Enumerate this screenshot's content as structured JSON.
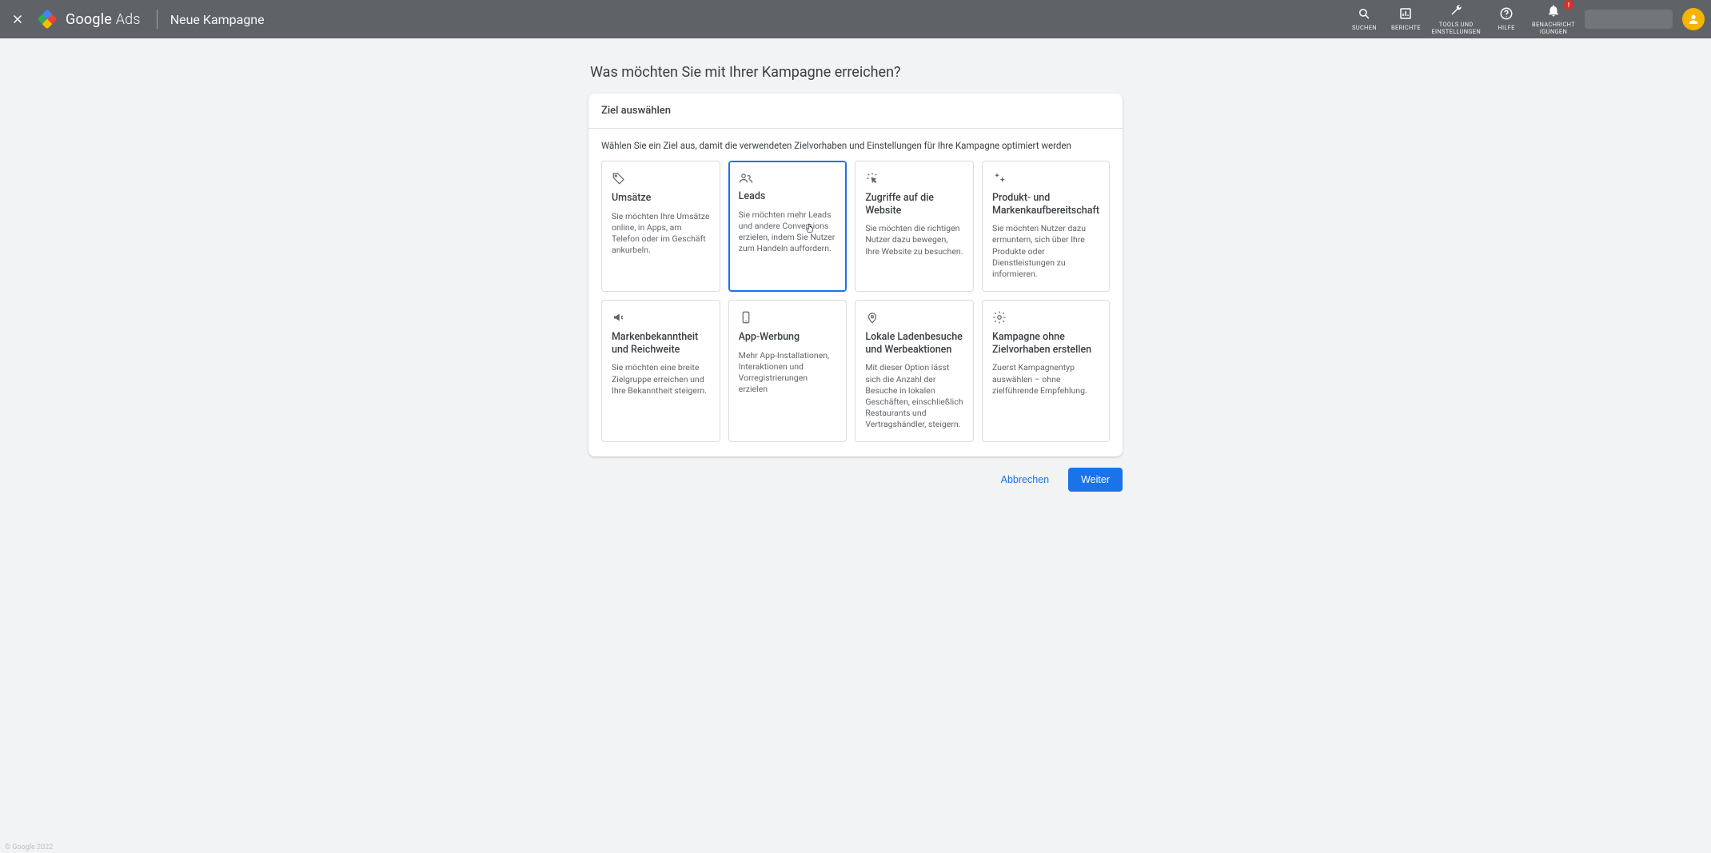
{
  "header": {
    "brand_google": "Google",
    "brand_ads": "Ads",
    "page_name": "Neue Kampagne",
    "tools": {
      "search": "SUCHEN",
      "reports": "BERICHTE",
      "settings_line1": "TOOLS UND",
      "settings_line2": "EINSTELLUNGEN",
      "help": "HILFE",
      "notif_line1": "BENACHRICHT",
      "notif_line2": "IGUNGEN",
      "notif_badge": "!"
    }
  },
  "main": {
    "question": "Was möchten Sie mit Ihrer Kampagne erreichen?",
    "card_title": "Ziel auswählen",
    "card_sub": "Wählen Sie ein Ziel aus, damit die verwendeten Zielvorhaben und Einstellungen für Ihre Kampagne optimiert werden",
    "goals": [
      {
        "id": "sales",
        "title": "Umsätze",
        "desc": "Sie möchten Ihre Umsätze online, in Apps, am Telefon oder im Geschäft ankurbeln.",
        "selected": false
      },
      {
        "id": "leads",
        "title": "Leads",
        "desc": "Sie möchten mehr Leads und andere Conversions erzielen, indem Sie Nutzer zum Handeln auffordern.",
        "selected": true
      },
      {
        "id": "traffic",
        "title": "Zugriffe auf die Website",
        "desc": "Sie möchten die richtigen Nutzer dazu bewegen, Ihre Website zu besuchen.",
        "selected": false
      },
      {
        "id": "consideration",
        "title": "Produkt- und Markenkaufbereitschaft",
        "desc": "Sie möchten Nutzer dazu ermuntern, sich über Ihre Produkte oder Dienstleistungen zu informieren.",
        "selected": false
      },
      {
        "id": "awareness",
        "title": "Markenbekanntheit und Reichweite",
        "desc": "Sie möchten eine breite Zielgruppe erreichen und Ihre Bekanntheit steigern.",
        "selected": false
      },
      {
        "id": "app",
        "title": "App-Werbung",
        "desc": "Mehr App-Installationen, Interaktionen und Vorregistrierungen erzielen",
        "selected": false
      },
      {
        "id": "local",
        "title": "Lokale Ladenbesuche und Werbeaktionen",
        "desc": "Mit dieser Option lässt sich die Anzahl der Besuche in lokalen Geschäften, einschließlich Restaurants und Vertragshändler, steigern.",
        "selected": false
      },
      {
        "id": "none",
        "title": "Kampagne ohne Zielvorhaben erstellen",
        "desc": "Zuerst Kampagnentyp auswählen – ohne zielführende Empfehlung.",
        "selected": false
      }
    ]
  },
  "actions": {
    "cancel": "Abbrechen",
    "next": "Weiter"
  },
  "footer": {
    "copyright": "© Google 2022"
  },
  "icons": {
    "sales": "tag-icon",
    "leads": "people-icon",
    "traffic": "click-icon",
    "consideration": "sparkle-icon",
    "awareness": "megaphone-icon",
    "app": "phone-icon",
    "local": "pin-icon",
    "none": "gear-icon"
  }
}
